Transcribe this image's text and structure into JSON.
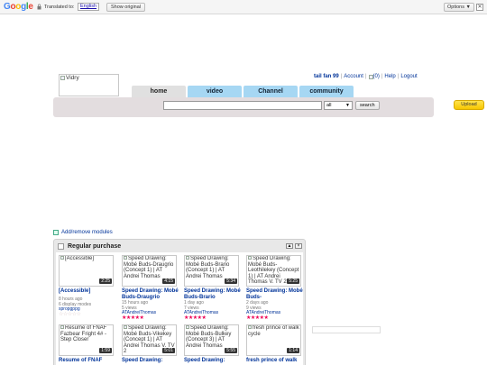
{
  "translate_bar": {
    "logo": [
      "G",
      "o",
      "o",
      "g",
      "l",
      "e"
    ],
    "translated_to_label": "Translated to:",
    "language": "English",
    "show_original": "Show original",
    "options": "Options ▼",
    "close": "✕"
  },
  "header": {
    "logo_alt": "Vidry",
    "username": "tail fan 99",
    "account": "Account",
    "inbox_count": "(0)",
    "help": "Help",
    "logout": "Logout"
  },
  "tabs": [
    "home",
    "video",
    "Channel",
    "community"
  ],
  "search": {
    "value": "",
    "scope": "all",
    "button": "search",
    "upload": "Upload"
  },
  "modules_link": "Add/remove modules",
  "module": {
    "title": "Regular purchase",
    "cards": [
      {
        "thumb_alt": "[Accessible]",
        "duration": "2:25",
        "title": "[Accessible]",
        "meta": [
          "8 hours ago",
          "6 display modes"
        ],
        "author": "spropgppg",
        "rating": 0
      },
      {
        "thumb_alt": "Speed Drawing: Mobé Buds-Draugrio (Concept 1) | AT Andrei Thomas",
        "duration": "4:15",
        "title": "Speed Drawing: Mobé Buds-Draugrio",
        "meta": [
          "15 hours ago",
          "5 views"
        ],
        "author": "ATAndreiThomas",
        "rating": 5
      },
      {
        "thumb_alt": "Speed Drawing: Mobé Buds-Brario (Concept 1) | AT Andrei Thomas",
        "duration": "5:34",
        "title": "Speed Drawing: Mobé Buds-Brario",
        "meta": [
          "1 day ago",
          "7 views"
        ],
        "author": "ATAndreiThomas",
        "rating": 5
      },
      {
        "thumb_alt": "Speed Drawing: Mobé Buds-Leothilekey (Concept 1) | AT Andrei Thomas V. TV 2",
        "duration": "5:25",
        "title": "Speed Drawing: Mobé Buds-",
        "meta": [
          "2 days ago",
          "9 views"
        ],
        "author": "ATAndreiThomas",
        "rating": 5
      },
      {
        "thumb_alt": "Resume of FNAF Fazbear Fright 4# - Step Closer",
        "duration": "1:59",
        "title": "Resume of FNAF",
        "meta": [],
        "author": "",
        "rating": -1
      },
      {
        "thumb_alt": "Speed Drawing: Mobé Buds-Vikekey (Concept 1) | AT Andrei Thomas V. TV 2",
        "duration": "5:01",
        "title": "Speed Drawing:",
        "meta": [],
        "author": "",
        "rating": -1
      },
      {
        "thumb_alt": "Speed Drawing: Mobé Buds-Bulkey (Concept 3) | AT Andrei Thomas",
        "duration": "5:55",
        "title": "Speed Drawing:",
        "meta": [],
        "author": "",
        "rating": -1
      },
      {
        "thumb_alt": "fresh prince of walk cycle",
        "duration": "1:14",
        "title": "fresh prince of walk",
        "meta": [],
        "author": "",
        "rating": -1
      }
    ]
  }
}
